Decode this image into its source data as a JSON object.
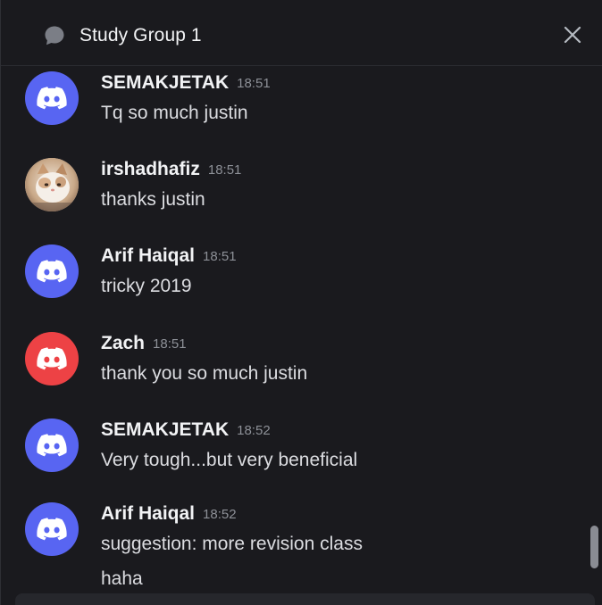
{
  "header": {
    "title": "Study Group 1",
    "thread_icon": "chat-bubble-icon",
    "close_icon": "close-icon"
  },
  "colors": {
    "background": "#1a1a1e",
    "blurple": "#5865f2",
    "red": "#ed4245"
  },
  "messages": [
    {
      "username": "SEMAKJETAK",
      "time": "18:51",
      "text": "Tq so much justin",
      "avatar": "discord-logo-icon",
      "avatar_color": "#5865f2"
    },
    {
      "username": "irshadhafiz",
      "time": "18:51",
      "text": "thanks justin",
      "avatar": "cat-photo-avatar",
      "avatar_color": "#cdb49a"
    },
    {
      "username": "Arif Haiqal",
      "time": "18:51",
      "text": "tricky 2019",
      "avatar": "discord-logo-icon",
      "avatar_color": "#5865f2"
    },
    {
      "username": "Zach",
      "time": "18:51",
      "text": "thank you so much justin",
      "avatar": "discord-logo-icon",
      "avatar_color": "#ed4245"
    },
    {
      "username": "SEMAKJETAK",
      "time": "18:52",
      "text": "Very tough...but very beneficial",
      "avatar": "discord-logo-icon",
      "avatar_color": "#5865f2"
    },
    {
      "username": "Arif Haiqal",
      "time": "18:52",
      "text": "suggestion: more revision class",
      "text2": "haha",
      "avatar": "discord-logo-icon",
      "avatar_color": "#5865f2"
    }
  ]
}
